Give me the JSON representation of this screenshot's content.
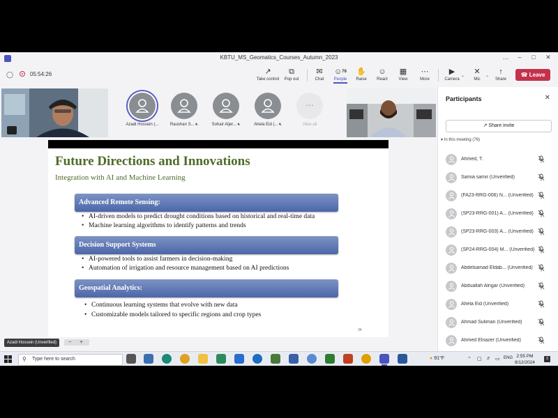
{
  "window": {
    "title": "KBTU_MS_Geomatics_Courses_Autumn_2023"
  },
  "meeting": {
    "timer": "05:54:26",
    "toolbar": [
      {
        "key": "take-control",
        "label": "Take control",
        "icon": "↗"
      },
      {
        "key": "pop-out",
        "label": "Pop out",
        "icon": "⧉"
      },
      {
        "key": "chat",
        "label": "Chat",
        "icon": "✉"
      },
      {
        "key": "people",
        "label": "People",
        "icon": "☺",
        "count": "76"
      },
      {
        "key": "raise",
        "label": "Raise",
        "icon": "✋"
      },
      {
        "key": "react",
        "label": "React",
        "icon": "☺"
      },
      {
        "key": "view",
        "label": "View",
        "icon": "▦"
      },
      {
        "key": "more",
        "label": "More",
        "icon": "⋯"
      },
      {
        "key": "camera",
        "label": "Camera",
        "icon": "▶"
      },
      {
        "key": "mic",
        "label": "Mic",
        "icon": "✕"
      },
      {
        "key": "share",
        "label": "Share",
        "icon": "↑"
      }
    ],
    "leave_label": "Leave"
  },
  "strip": {
    "avatars": [
      {
        "name": "Azadi Hossein (...",
        "speaking": true
      },
      {
        "name": "Raushan S...",
        "muted": true
      },
      {
        "name": "Sohair Aljer...",
        "muted": true
      },
      {
        "name": "Ahela Eid (...",
        "muted": true
      }
    ],
    "view_all": "View all"
  },
  "participants": {
    "title": "Participants",
    "share_invite": "Share invite",
    "section_label": "In this meeting (76)",
    "list": [
      "Ahmed, T.",
      "Samia samir (Unverified)",
      "(FA23-RRG-006) N... (Unverified)",
      "(SP23-RRG-001) A... (Unverified)",
      "(SP23-RRG-003) A... (Unverified)",
      "(SP24-RRG-004) M... (Unverified)",
      "Abdelsamad Eldab... (Unverified)",
      "Abduallah Alngar (Unverified)",
      "Ahela Eid (Unverified)",
      "Ahmad Suliman (Unverified)",
      "Ahmed Elnazer (Unverified)"
    ]
  },
  "slide": {
    "title": "Future Directions and Innovations",
    "subtitle": "Integration with AI and Machine Learning",
    "sections": [
      {
        "heading": "Advanced Remote Sensing:",
        "bullets": [
          "AI-driven models to predict drought conditions based on historical and real-time data",
          "Machine learning algorithms to identify patterns and trends"
        ]
      },
      {
        "heading": "Decision Support Systems",
        "bullets": [
          "AI-powered tools to assist farmers in decision-making",
          "Automation of irrigation and resource management based on AI predictions"
        ]
      },
      {
        "heading": "Geospatial Analytics:",
        "bullets": [
          "Continuous learning systems that evolve with new data",
          "Customizable models tailored to specific regions and crop types"
        ]
      }
    ],
    "page_number": "34"
  },
  "presenter_label": "Azadi Hossein (Unverified)",
  "zoom": {
    "minus": "−",
    "plus": "+"
  },
  "taskbar": {
    "search_placeholder": "Type here to search",
    "weather": "91°F",
    "language": "ENG",
    "time": "2:55 PM",
    "date": "8/12/2024",
    "notifications": "3"
  },
  "colors": {
    "teams_accent": "#4b53bc",
    "leave": "#c4314b",
    "slide_title": "#4e6b28",
    "section_bar": "#5a72b0"
  }
}
